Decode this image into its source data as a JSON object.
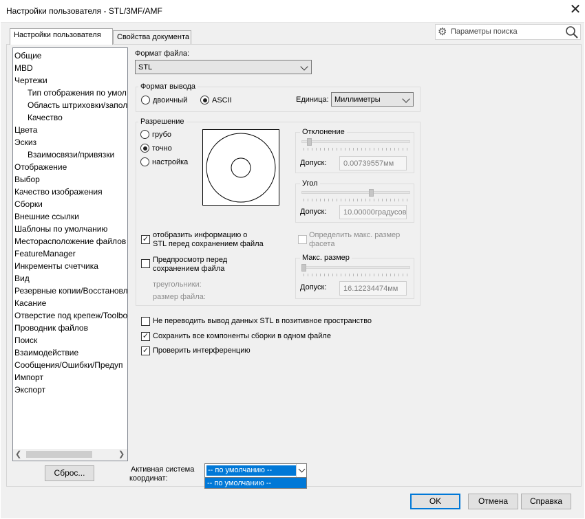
{
  "window": {
    "title": "Настройки пользователя - STL/3MF/AMF"
  },
  "tabs": {
    "user": "Настройки пользователя",
    "doc": "Свойства документа"
  },
  "search": {
    "placeholder": "Параметры поиска"
  },
  "tree": {
    "items": [
      "Общие",
      "MBD",
      "Чертежи",
      "Тип отображения по умол",
      "Область штриховки/запол",
      "Качество",
      "Цвета",
      "Эскиз",
      "Взаимосвязи/привязки",
      "Отображение",
      "Выбор",
      "Качество изображения",
      "Сборки",
      "Внешние ссылки",
      "Шаблоны по умолчанию",
      "Месторасположение файлов",
      "FeatureManager",
      "Инкременты счетчика",
      "Вид",
      "Резервные копии/Восстановл",
      "Касание",
      "Отверстие под крепеж/Toolbo",
      "Проводник файлов",
      "Поиск",
      "Взаимодействие",
      "Сообщения/Ошибки/Предуп",
      "Импорт",
      "Экспорт"
    ]
  },
  "buttons": {
    "reset": "Сброс...",
    "ok": "OK",
    "cancel": "Отмена",
    "help": "Справка"
  },
  "file_format": {
    "label": "Формат файла:",
    "value": "STL"
  },
  "output_format": {
    "title": "Формат вывода",
    "binary": "двоичный",
    "ascii": "ASCII",
    "selected": "ASCII",
    "unit_label": "Единица:",
    "unit_value": "Миллиметры"
  },
  "resolution": {
    "title": "Разрешение",
    "options": [
      "грубо",
      "точно",
      "настройка"
    ],
    "selected": "точно",
    "deviation": {
      "title": "Отклонение",
      "tol_label": "Допуск:",
      "tol_value": "0.00739557мм",
      "slider_level": 0.05
    },
    "angle": {
      "title": "Угол",
      "tol_label": "Допуск:",
      "tol_value": "10.00000градусов",
      "slider_level": 0.65
    },
    "max_size": {
      "checkbox": "Определить макс. размер фасета",
      "checked": false,
      "title": "Макс. размер",
      "tol_label": "Допуск:",
      "tol_value": "16.12234474мм",
      "slider_level": 0.0
    },
    "show_info": {
      "label": "отобразить информацию о STL перед сохранением файла",
      "line1": "отобразить информацию о",
      "line2": "STL перед сохранением файла",
      "checked": true
    },
    "preview": {
      "label": "Предпросмотр перед сохранением файла",
      "line1": "Предпросмотр перед",
      "line2": "сохранением файла",
      "checked": false
    },
    "triangles_label": "треугольники:",
    "filesize_label": "размер файла:"
  },
  "options": [
    {
      "label": "Не переводить вывод данных STL в позитивное пространство",
      "checked": false
    },
    {
      "label": "Сохранить все компоненты сборки в одном файле",
      "checked": true
    },
    {
      "label": "Проверить интерференцию",
      "checked": true
    }
  ],
  "coordinate_system": {
    "label_line1": "Активная система",
    "label_line2": "координат:",
    "value": "-- по умолчанию --",
    "dropdown_item": "-- по умолчанию --"
  }
}
